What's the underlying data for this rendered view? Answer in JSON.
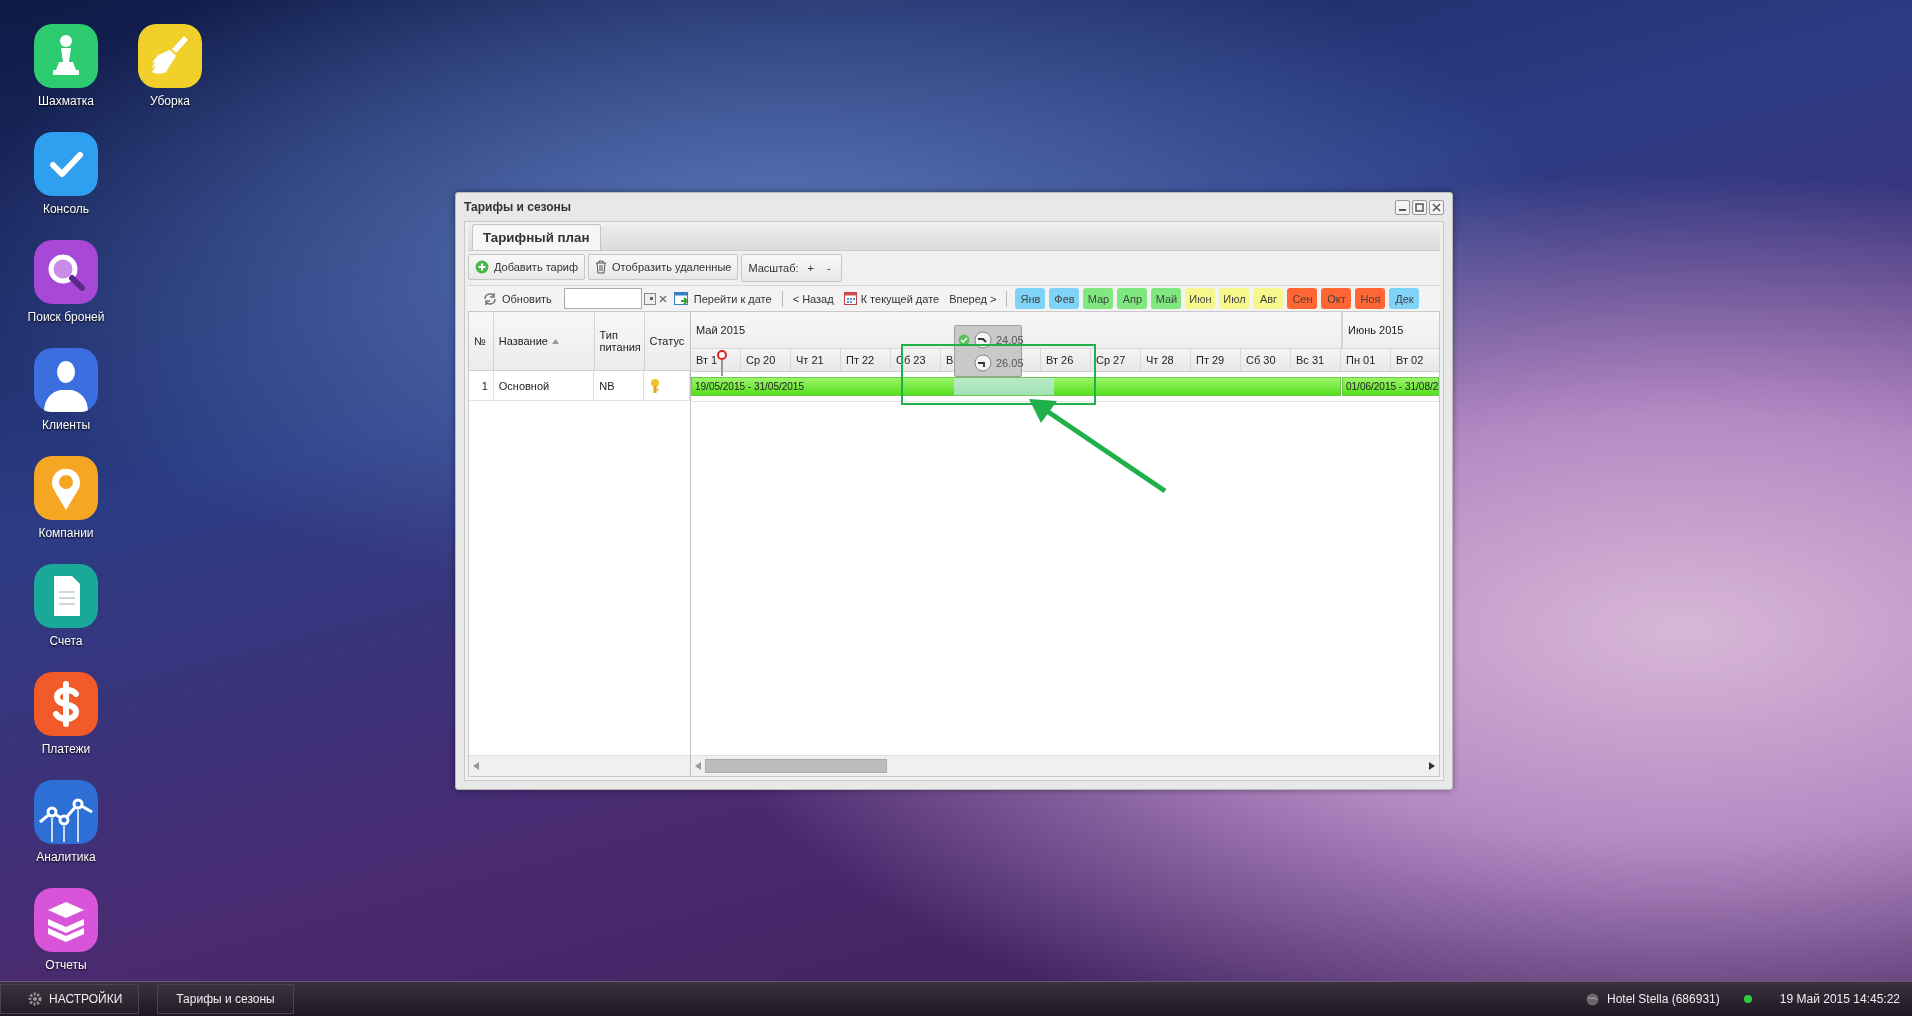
{
  "desktop_icons": [
    {
      "label": "Шахматка",
      "kind": "pawn",
      "color": "#2ecc71"
    },
    {
      "label": "Уборка",
      "kind": "broom",
      "color": "#f1d02c"
    },
    {
      "label": "Консоль",
      "kind": "check",
      "color": "#2f9ff0"
    },
    {
      "label": "Поиск броней",
      "kind": "search",
      "color": "#a848d6"
    },
    {
      "label": "Клиенты",
      "kind": "person",
      "color": "#3b6fe0"
    },
    {
      "label": "Компании",
      "kind": "pin",
      "color": "#f5a623"
    },
    {
      "label": "Счета",
      "kind": "document",
      "color": "#1aa899"
    },
    {
      "label": "Платежи",
      "kind": "dollar",
      "color": "#f25a2a"
    },
    {
      "label": "Аналитика",
      "kind": "chart",
      "color": "#2e6fd6"
    },
    {
      "label": "Отчеты",
      "kind": "books",
      "color": "#d855d9"
    }
  ],
  "window": {
    "title": "Тарифы и сезоны",
    "tabs": [
      {
        "label": "Тарифный план",
        "selected": true
      }
    ],
    "toolbar": {
      "add_button": "Добавить тариф",
      "deleted_button": "Отобразить удаленные",
      "scale_label": "Масштаб:",
      "zoom_in": "+",
      "zoom_out": "-"
    },
    "nav": {
      "refresh": "Обновить",
      "goto": "Перейти к дате",
      "back": "< Назад",
      "today": "К текущей дате",
      "forward": "Вперед >"
    },
    "months": [
      {
        "label": "Янв",
        "color": "#7fd3f7"
      },
      {
        "label": "Фев",
        "color": "#7fd3f7"
      },
      {
        "label": "Мар",
        "color": "#7fe87f"
      },
      {
        "label": "Апр",
        "color": "#7fe87f"
      },
      {
        "label": "Май",
        "color": "#7fe87f"
      },
      {
        "label": "Июн",
        "color": "#f7f78c"
      },
      {
        "label": "Июл",
        "color": "#f7f78c"
      },
      {
        "label": "Авг",
        "color": "#f7f78c"
      },
      {
        "label": "Сен",
        "color": "#ff6633"
      },
      {
        "label": "Окт",
        "color": "#ff6633"
      },
      {
        "label": "Ноя",
        "color": "#ff6633"
      },
      {
        "label": "Дек",
        "color": "#7fd3f7"
      }
    ],
    "columns": [
      {
        "label": "№",
        "sorted": false
      },
      {
        "label": "Название",
        "sorted": true
      },
      {
        "label": "Тип питания",
        "sorted": false
      },
      {
        "label": "Статус",
        "sorted": false
      }
    ],
    "rows": [
      {
        "number": "1",
        "name": "Основной",
        "meal": "NB",
        "active": true
      }
    ],
    "timeline": {
      "months": [
        "Май 2015",
        "Июнь 2015"
      ],
      "days_before": [
        "Вт 1",
        "Ср 20",
        "Чт 21",
        "Пт 22",
        "Сб 23"
      ],
      "tooltip": {
        "partial_day": "В",
        "start": "24.05",
        "end": "26.05"
      },
      "days_after": [
        "Вт 26",
        "Ср 27",
        "Чт 28",
        "Пт 29",
        "Сб 30",
        "Вс 31",
        "Пн 01",
        "Вт 02"
      ],
      "bars": [
        {
          "label": "19/05/2015 - 31/05/2015",
          "selected_segment": true
        },
        {
          "label": "01/06/2015 - 31/08/2",
          "selected_segment": false
        }
      ]
    }
  },
  "taskbar": {
    "settings": "НАСТРОЙКИ",
    "tasks": [
      {
        "label": "Тарифы и сезоны"
      }
    ],
    "hotel": "Hotel Stella (686931)",
    "online": true,
    "datetime": "19 Май 2015 14:45:22"
  }
}
